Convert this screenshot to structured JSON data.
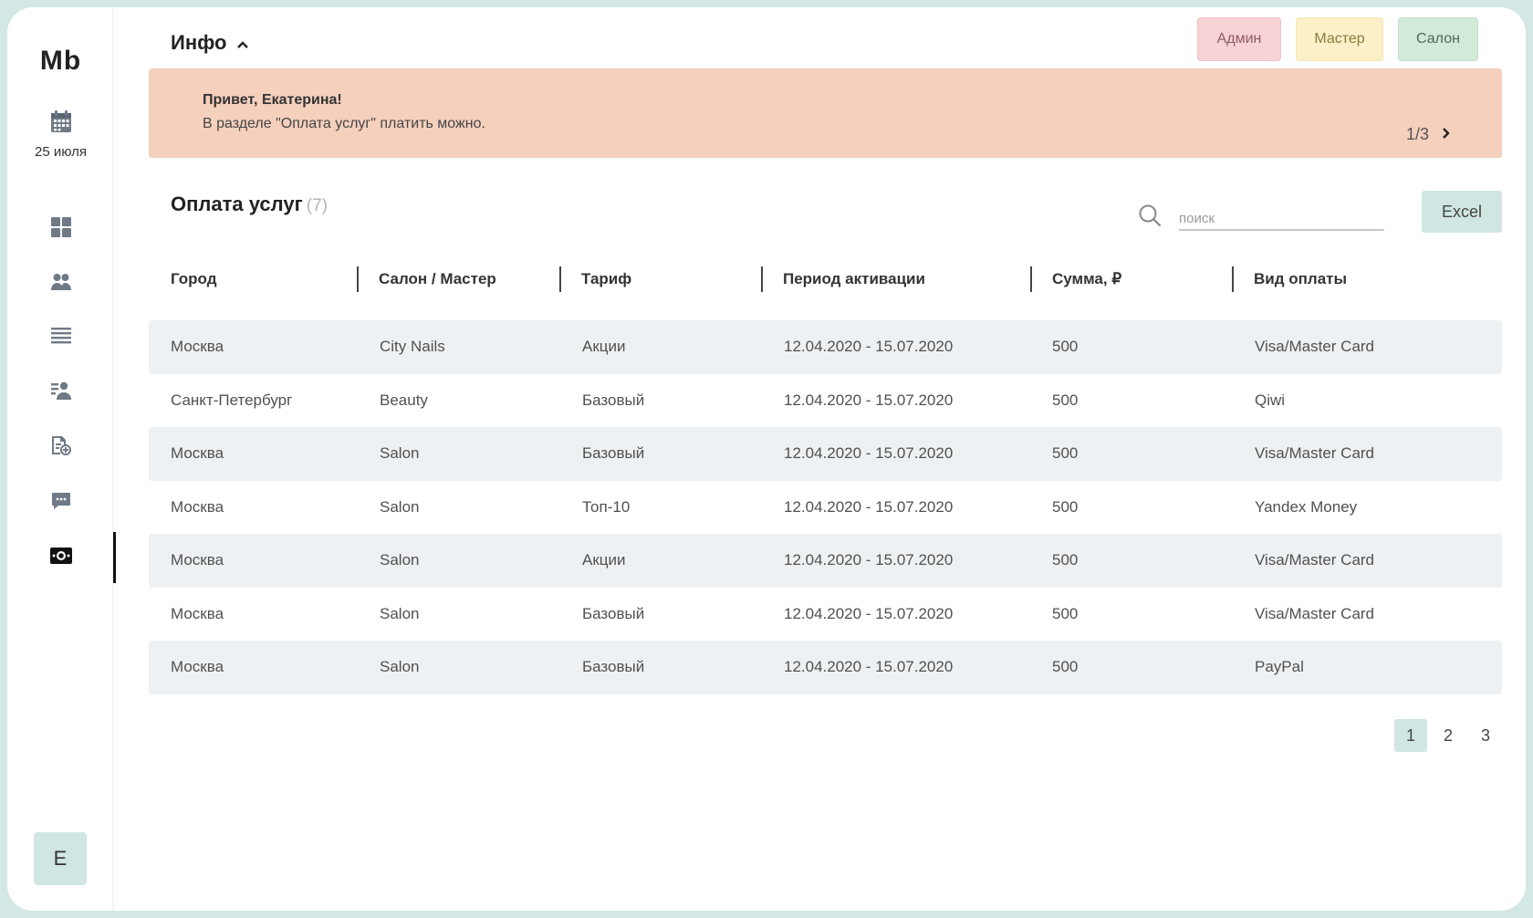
{
  "sidebar": {
    "logo": "Mb",
    "date": "25 июля",
    "user_initial": "E"
  },
  "header": {
    "info_label": "Инфо",
    "roles": [
      {
        "label": "Админ",
        "bg": "#f7d3d6",
        "fg": "#8c5b62"
      },
      {
        "label": "Мастер",
        "bg": "#fbf0c7",
        "fg": "#8c7a42"
      },
      {
        "label": "Салон",
        "bg": "#d2ebd9",
        "fg": "#4e6b57"
      }
    ]
  },
  "banner": {
    "title": "Привет, Екатерина!",
    "text": "В разделе \"Оплата услуг\" платить можно.",
    "pager": "1/3",
    "bg": "#f5d0bd"
  },
  "section": {
    "title": "Оплата услуг",
    "count": "(7)"
  },
  "search": {
    "placeholder": "поиск"
  },
  "excel_label": "Excel",
  "table": {
    "columns": [
      "Город",
      "Салон / Мастер",
      "Тариф",
      "Период активации",
      "Сумма, ₽",
      "Вид оплаты"
    ],
    "rows": [
      [
        "Москва",
        "City Nails",
        "Акции",
        "12.04.2020 - 15.07.2020",
        "500",
        "Visa/Master Card"
      ],
      [
        "Санкт-Петербург",
        "Beauty",
        "Базовый",
        "12.04.2020 - 15.07.2020",
        "500",
        "Qiwi"
      ],
      [
        "Москва",
        "Salon",
        "Базовый",
        "12.04.2020 - 15.07.2020",
        "500",
        "Visa/Master Card"
      ],
      [
        "Москва",
        "Salon",
        "Топ-10",
        "12.04.2020 - 15.07.2020",
        "500",
        "Yandex Money"
      ],
      [
        "Москва",
        "Salon",
        "Акции",
        "12.04.2020 - 15.07.2020",
        "500",
        "Visa/Master Card"
      ],
      [
        "Москва",
        "Salon",
        "Базовый",
        "12.04.2020 - 15.07.2020",
        "500",
        "Visa/Master Card"
      ],
      [
        "Москва",
        "Salon",
        "Базовый",
        "12.04.2020 - 15.07.2020",
        "500",
        "PayPal"
      ]
    ]
  },
  "pagination": {
    "pages": [
      "1",
      "2",
      "3"
    ],
    "current": "1"
  },
  "colors": {
    "accent": "#cfe6e2",
    "row_stripe": "#eef1f3",
    "frame": "#d3e8e4"
  }
}
